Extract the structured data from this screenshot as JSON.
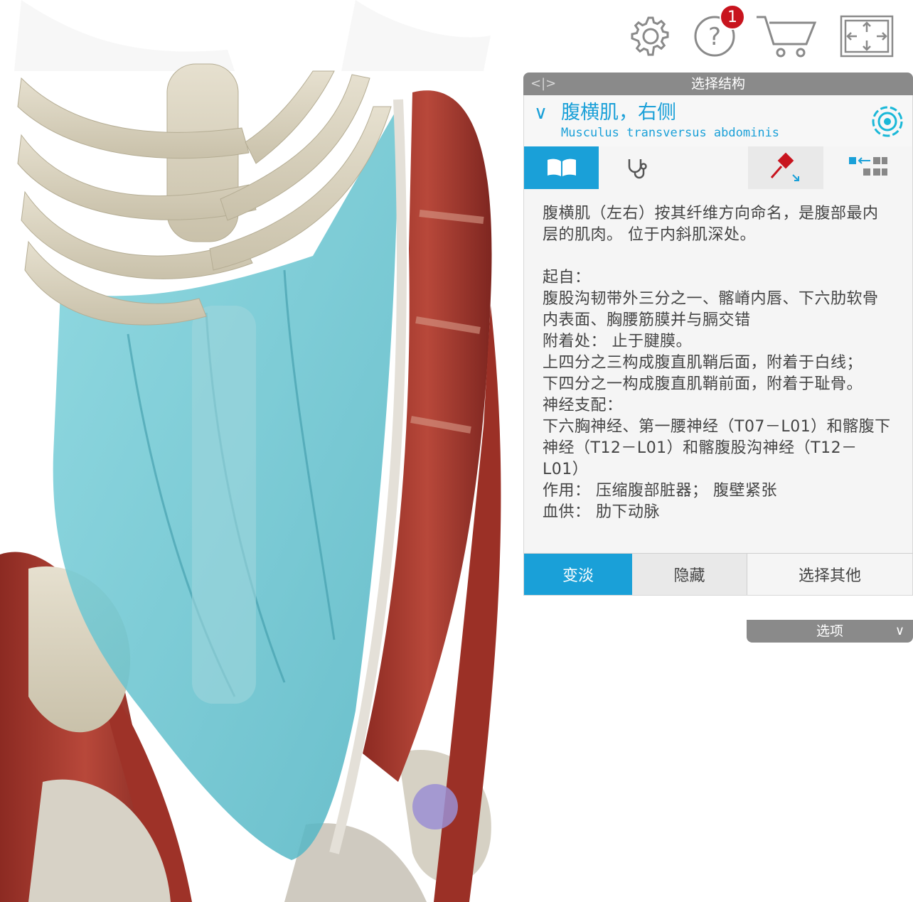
{
  "toolbar": {
    "settings_icon": "gear-icon",
    "help_icon": "help-icon",
    "help_badge": "1",
    "cart_icon": "cart-icon",
    "fullscreen_icon": "fullscreen-icon"
  },
  "panel": {
    "collapse_label": "<|>",
    "title": "选择结构",
    "structure": {
      "name_cn": "腹横肌，右侧",
      "name_latin": "Musculus transversus abdominis"
    },
    "tabs": [
      {
        "icon": "book-icon",
        "active": true
      },
      {
        "icon": "stethoscope-icon",
        "active": false
      },
      {
        "icon": "pin-icon",
        "active": false
      },
      {
        "icon": "grid-arrange-icon",
        "active": false
      }
    ],
    "description": "腹横肌（左右）按其纤维方向命名，是腹部最内层的肌肉。 位于内斜肌深处。\n\n起自：\n腹股沟韧带外三分之一、髂嵴内唇、下六肋软骨内表面、胸腰筋膜并与膈交错\n附着处： 止于腱膜。\n上四分之三构成腹直肌鞘后面，附着于白线；\n下四分之一构成腹直肌鞘前面，附着于耻骨。\n神经支配：\n下六胸神经、第一腰神经（T07－L01）和髂腹下神经（T12－L01）和髂腹股沟神经（T12－L01）\n作用： 压缩腹部脏器； 腹壁紧张\n血供： 肋下动脉",
    "actions": {
      "fade": "变淡",
      "hide": "隐藏",
      "select_other": "选择其他"
    },
    "options_label": "选项"
  },
  "colors": {
    "accent": "#1aa0d8",
    "badge": "#c8141e",
    "header_grey": "#8a8a8a",
    "muscle_red": "#a8392e",
    "highlight_cyan": "#5ec6d4",
    "bone": "#d9d3c2"
  }
}
